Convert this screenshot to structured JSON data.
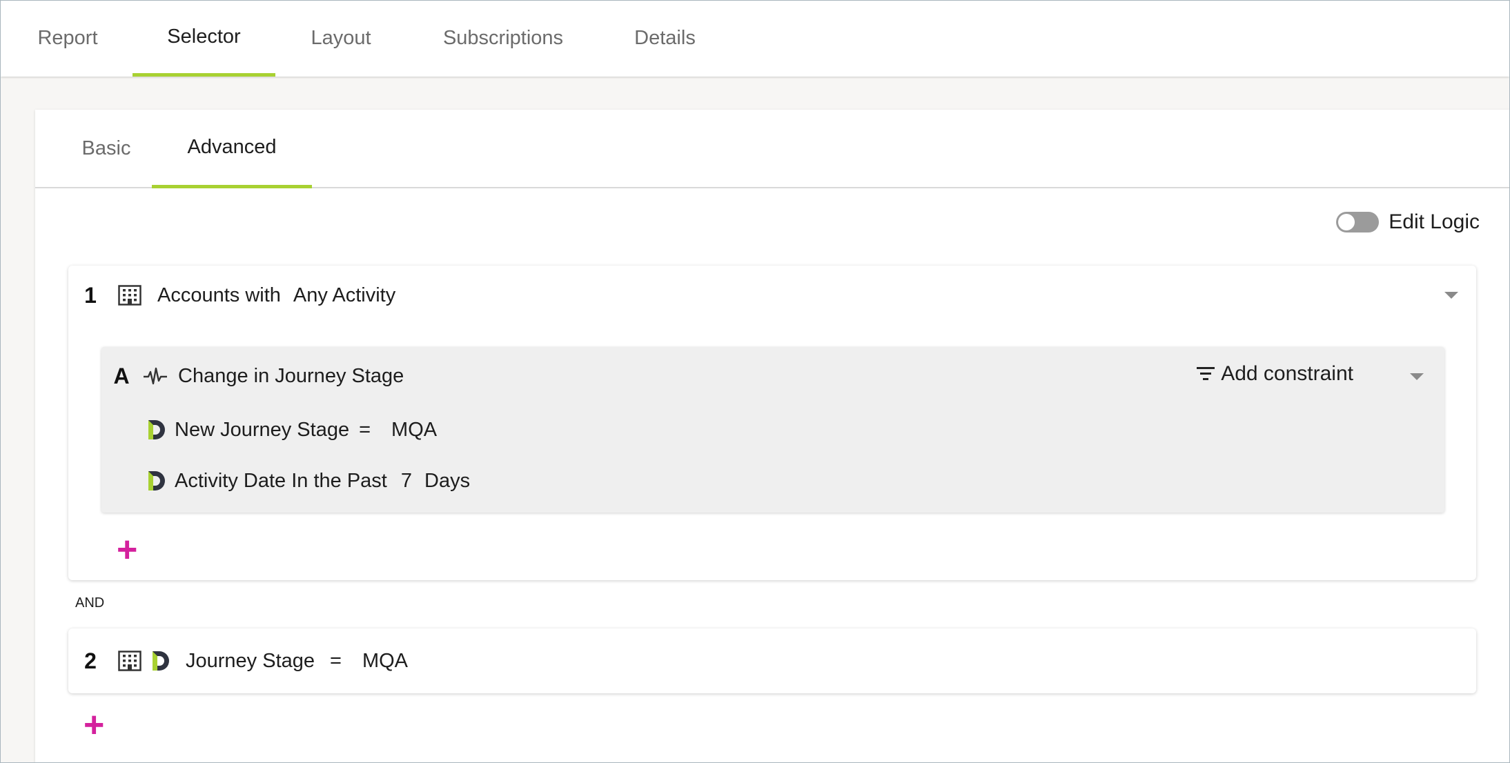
{
  "top_tabs": [
    {
      "label": "Report"
    },
    {
      "label": "Selector"
    },
    {
      "label": "Layout"
    },
    {
      "label": "Subscriptions"
    },
    {
      "label": "Details"
    }
  ],
  "top_tabs_active": "Selector",
  "sub_tabs": [
    {
      "label": "Basic"
    },
    {
      "label": "Advanced"
    }
  ],
  "sub_tabs_active": "Advanced",
  "edit_logic": {
    "label": "Edit Logic",
    "enabled": false
  },
  "groups": [
    {
      "number": "1",
      "icon": "building-icon",
      "prefix": "Accounts with",
      "activity": "Any Activity",
      "subgroup": {
        "letter": "A",
        "icon": "activity-pulse-icon",
        "title": "Change in Journey Stage",
        "add_constraint": "Add constraint",
        "constraints": [
          {
            "icon": "d-logo-icon",
            "field": "New Journey Stage",
            "operator": "=",
            "value": "MQA",
            "extra": ""
          },
          {
            "icon": "d-logo-icon",
            "field": "Activity Date In the Past",
            "operator": "",
            "value": "7",
            "extra": "Days"
          }
        ]
      }
    },
    {
      "number": "2",
      "icon": "building-icon",
      "icon2": "d-logo-icon",
      "field": "Journey Stage",
      "operator": "=",
      "value": "MQA"
    }
  ],
  "join_operator": "AND",
  "colors": {
    "accent": "#a8d132",
    "plus": "#d4219d",
    "toggle_off": "#9b9b9b"
  }
}
